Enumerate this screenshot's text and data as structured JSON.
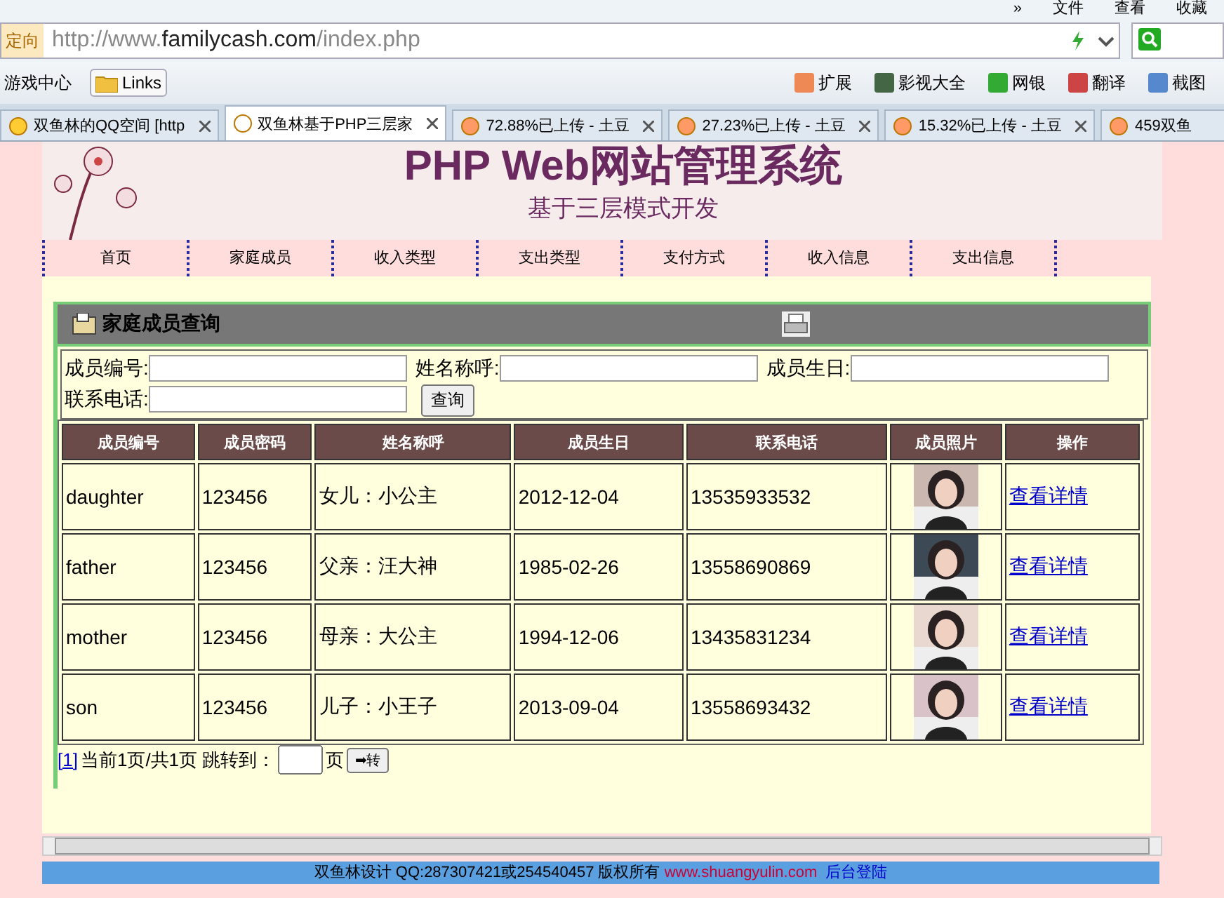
{
  "browser": {
    "menu": [
      "»",
      "文件",
      "查看",
      "收藏"
    ],
    "address_tag": "定向",
    "url_prefix": "http://www.",
    "url_domain": "familycash.com",
    "url_path": "/index.php",
    "toolbar_left": [
      "游戏中心",
      "Links"
    ],
    "toolbar_right": [
      "扩展",
      "影视大全",
      "网银",
      "翻译",
      "截图"
    ],
    "tabs": [
      {
        "label": "双鱼林的QQ空间 [http",
        "selected": false
      },
      {
        "label": "双鱼林基于PHP三层家",
        "selected": true
      },
      {
        "label": "72.88%已上传 - 土豆",
        "selected": false
      },
      {
        "label": "27.23%已上传 - 土豆",
        "selected": false
      },
      {
        "label": "15.32%已上传 - 土豆",
        "selected": false
      },
      {
        "label": "459双鱼",
        "selected": false
      }
    ]
  },
  "banner": {
    "title": "PHP Web网站管理系统",
    "subtitle": "基于三层模式开发"
  },
  "nav": [
    "首页",
    "家庭成员",
    "收入类型",
    "支出类型",
    "支付方式",
    "收入信息",
    "支出信息"
  ],
  "panel": {
    "title": "家庭成员查询"
  },
  "search": {
    "fields": [
      {
        "label": "成员编号:"
      },
      {
        "label": "姓名称呼:"
      },
      {
        "label": "成员生日:"
      },
      {
        "label": "联系电话:"
      }
    ],
    "button": "查询"
  },
  "table": {
    "columns": [
      "成员编号",
      "成员密码",
      "姓名称呼",
      "成员生日",
      "联系电话",
      "成员照片",
      "操作"
    ],
    "rows": [
      {
        "id": "daughter",
        "password": "123456",
        "name": "女儿：小公主",
        "birthday": "2012-12-04",
        "phone": "13535933532",
        "action": "查看详情"
      },
      {
        "id": "father",
        "password": "123456",
        "name": "父亲：汪大神",
        "birthday": "1985-02-26",
        "phone": "13558690869",
        "action": "查看详情"
      },
      {
        "id": "mother",
        "password": "123456",
        "name": "母亲：大公主",
        "birthday": "1994-12-06",
        "phone": "13435831234",
        "action": "查看详情"
      },
      {
        "id": "son",
        "password": "123456",
        "name": "儿子：小王子",
        "birthday": "2013-09-04",
        "phone": "13558693432",
        "action": "查看详情"
      }
    ]
  },
  "pager": {
    "page_link": "[1]",
    "status": "当前1页/共1页 跳转到：",
    "unit": "页",
    "go": "➡转"
  },
  "footer": {
    "text": "双鱼林设计 QQ:287307421或254540457  版权所有",
    "site": "www.shuangyulin.com",
    "login": "后台登陆"
  }
}
